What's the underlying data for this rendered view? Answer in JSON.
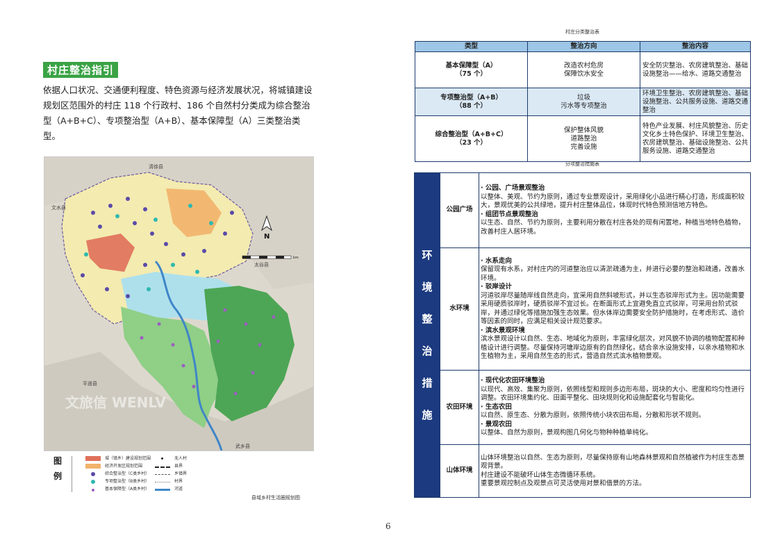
{
  "left": {
    "section_title": "村庄整治指引",
    "intro": "依据人口状况、交通便利程度、特色资源与经济发展状况，将城镇建设规划区范围外的村庄 118 个行政村、186 个自然村分类成为综合整治型（A+B+C）、专项整治型（A+B）、基本保障型（A）三类整治类型。",
    "map": {
      "place_labels": [
        "清徐县",
        "文水县",
        "太谷县",
        "平遥县",
        "武乡县"
      ],
      "compass": "N",
      "scale_unit": "km",
      "watermark": "文旅信 WENLV",
      "caption": "县域乡村生活圈规划图"
    },
    "legend": {
      "title_1": "图",
      "title_2": "例",
      "items_left": [
        {
          "label": "城（镇乡）建设规划范围",
          "color": "#e0705a"
        },
        {
          "label": "经济开发区规划范围",
          "color": "#f2b36b"
        },
        {
          "label": "综合整治型（C类乡村）",
          "color": "#5a4aa8"
        },
        {
          "label": "专项整治型（B类乡村）",
          "color": "#2fb8b0"
        },
        {
          "label": "基本保障型（A类乡村）",
          "color": "#9a5fc0"
        }
      ],
      "items_right": [
        {
          "label": "无人村"
        },
        {
          "label": "县界"
        },
        {
          "label": "乡镇界"
        },
        {
          "label": "村界"
        },
        {
          "label": "河道"
        }
      ]
    },
    "page_number": "6"
  },
  "table1": {
    "caption": "村庄分类整治表",
    "headers": [
      "类型",
      "整治方向",
      "整治内容"
    ],
    "rows": [
      {
        "type": "基本保障型（A）",
        "count": "（75 个）",
        "direction": [
          "改造农村危房",
          "保障饮水安全"
        ],
        "content": "安全防灾整治、农房建筑整治、基础设施整治——给水、道路交通整治"
      },
      {
        "type": "专项整治型（A+B）",
        "count": "（88 个）",
        "direction": [
          "垃圾",
          "污水等专项整治"
        ],
        "content": "环境卫生整治、农房建筑整治、基础设施整治、公共服务设施、道路交通整治"
      },
      {
        "type": "综合整治型（A+B+C）",
        "count": "（23 个）",
        "direction": [
          "保护整体风貌",
          "道路整治",
          "完善设施"
        ],
        "content": "特色产业发展、村庄风貌整治、历史文化乡土特色保护、环境卫生整治、农房建筑整治、基础设施整治、公共服务设施、道路交通整治"
      }
    ]
  },
  "table2": {
    "caption": "分项整治措施表",
    "side_title": [
      "环",
      "境",
      "整",
      "治",
      "措",
      "施"
    ],
    "rows": [
      {
        "category": "公园广场",
        "blocks": [
          {
            "heading": "· 公园、广场景观整治",
            "text": "以整体、美观、节约为原则，通过专业景观设计，采用绿化小品进行精心打造，形成面积较大，景观优美的公共绿地，提升村庄整体品位，体现时代特色预测信地方特色。"
          },
          {
            "heading": "· 组团节点景观整治",
            "text": "以生态、自然、节约为原则，主要利用分散在村庄各处的现有闲置地，种植当地特色植物，改善村庄人居环境。"
          }
        ]
      },
      {
        "category": "水环境",
        "blocks": [
          {
            "heading": "· 水系走向",
            "text": "保留现有水系，对村庄内的河道整治应以清淤疏通为主，并进行必要的整治和疏通，改善水环境。"
          },
          {
            "heading": "· 驳岸设计",
            "text": "河道驳岸尽量随岸线自然走向，宜采用自然斜坡形式，并以生态驳岸形式为主。因功能需要采用硬质驳岸时，硬质驳岸不宜过长。在断面形式上宜避免直立式驳岸，可采用台阶式驳岸，并通过绿化等措施加强生态效果。但水体岸边需要安全防护措施时，在考虑形式、造价等因素的同时，应满足相关设计规范要求。"
          },
          {
            "heading": "· 滨水景观环境",
            "text": "滨水景观设计以自然、生态、地域化为原则，丰富绿化层次，对风貌不协调的植物配置和种植设计进行调整。尽量保持河塘岸边原有的自然绿化，结合亲水设施安排，以亲水植物和水生植物为主，采用自然生态的形式，营造自然式滨水植物景观。"
          }
        ]
      },
      {
        "category": "农田环境",
        "blocks": [
          {
            "heading": "· 现代化农田环境整治",
            "text": "以现代、高效、集聚为原则，依照线型和规则多边形布局，斑块的大小、密度和均匀性进行调整。农田环境集约化、田面平整化、田块规则化和设施配套化与智能化。"
          },
          {
            "heading": "· 生态农田",
            "text": "以自然、原生态、分散为原则，依照传统小块农田布局，分散和形状不规则。"
          },
          {
            "heading": "· 景观农田",
            "text": "以整体、自然为原则，景观构图几何化与物种种植单纯化。"
          }
        ]
      },
      {
        "category": "山体环境",
        "blocks": [
          {
            "heading": "",
            "text": "山体环境整治以自然、生态为原则，尽量保持原有山地森林景观和自然植被作为村庄生态景观背景。"
          },
          {
            "heading": "",
            "text": "村庄建设不能破坏山体生态微循环系统。"
          },
          {
            "heading": "",
            "text": "重要景观控制点及观景点可灵活使用对景和借景的方法。"
          }
        ]
      }
    ]
  }
}
